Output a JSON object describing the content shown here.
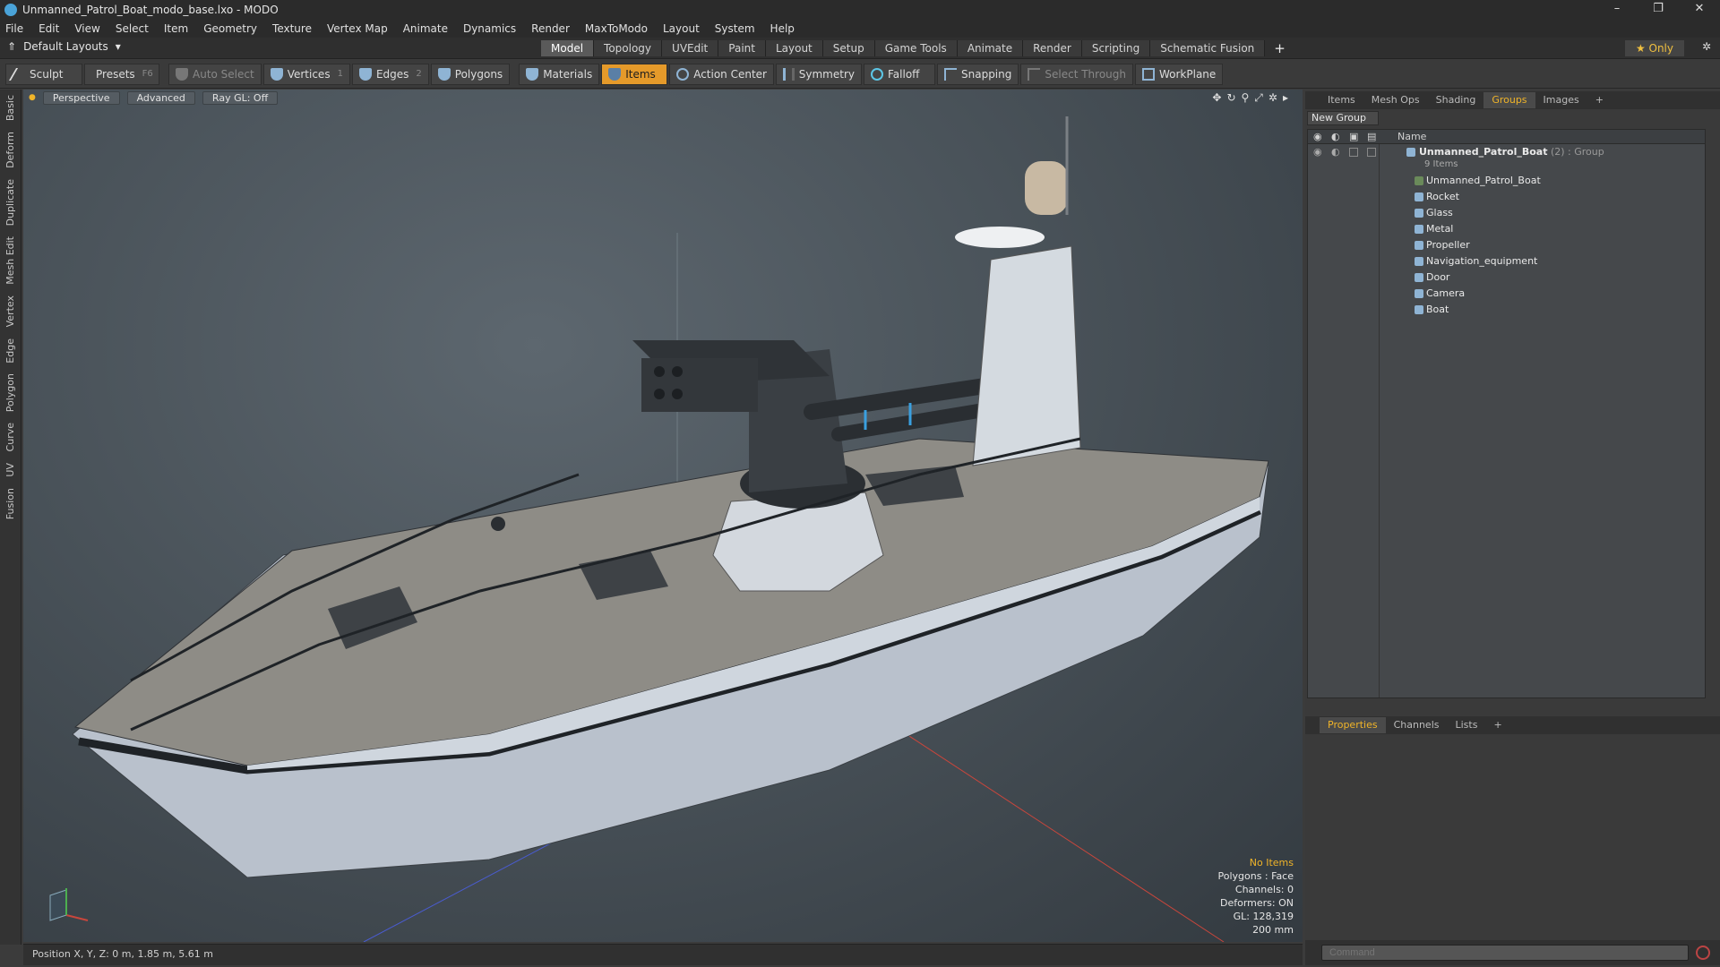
{
  "window": {
    "title": "Unmanned_Patrol_Boat_modo_base.lxo - MODO",
    "minimize": "–",
    "maximize": "❐",
    "close": "✕"
  },
  "menu": [
    "File",
    "Edit",
    "View",
    "Select",
    "Item",
    "Geometry",
    "Texture",
    "Vertex Map",
    "Animate",
    "Dynamics",
    "Render",
    "MaxToModo",
    "Layout",
    "System",
    "Help"
  ],
  "layouts": {
    "label": "Default Layouts"
  },
  "layout_tabs": {
    "items": [
      "Model",
      "Topology",
      "UVEdit",
      "Paint",
      "Layout",
      "Setup",
      "Game Tools",
      "Animate",
      "Render",
      "Scripting",
      "Schematic Fusion"
    ],
    "active": "Model",
    "add": "+",
    "only": "★ Only"
  },
  "toolbar": {
    "sculpt": "Sculpt",
    "presets": "Presets",
    "presets_key": "F6",
    "auto_select": "Auto Select",
    "vertices": "Vertices",
    "vertices_key": "1",
    "edges": "Edges",
    "edges_key": "2",
    "polygons": "Polygons",
    "materials": "Materials",
    "items": "Items",
    "action_center": "Action Center",
    "symmetry": "Symmetry",
    "falloff": "Falloff",
    "snapping": "Snapping",
    "select_through": "Select Through",
    "workplane": "WorkPlane"
  },
  "left_strip": [
    "Basic",
    "Deform",
    "Duplicate",
    "Mesh Edit",
    "Vertex",
    "Edge",
    "Polygon",
    "Curve",
    "UV",
    "Fusion"
  ],
  "viewport": {
    "view": "Perspective",
    "shading": "Advanced",
    "raygl": "Ray GL: Off",
    "info": {
      "selection": "No Items",
      "polygons": "Polygons : Face",
      "channels": "Channels: 0",
      "deformers": "Deformers: ON",
      "gl": "GL: 128,319",
      "scale": "200 mm"
    }
  },
  "status": {
    "position": "Position X, Y, Z:  0 m, 1.85 m, 5.61 m"
  },
  "right_tabs": {
    "items": [
      "Items",
      "Mesh Ops",
      "Shading",
      "Groups",
      "Images"
    ],
    "active": "Groups",
    "add": "+"
  },
  "groups": {
    "new_group": "New Group",
    "col_name": "Name",
    "group": {
      "name": "Unmanned_Patrol_Boat",
      "suffix": " (2) : Group",
      "count": "9 Items"
    },
    "items": [
      "Unmanned_Patrol_Boat",
      "Rocket",
      "Glass",
      "Metal",
      "Propeller",
      "Navigation_equipment",
      "Door",
      "Camera",
      "Boat"
    ]
  },
  "bottom_tabs": {
    "items": [
      "Properties",
      "Channels",
      "Lists"
    ],
    "active": "Properties",
    "add": "+"
  },
  "command": {
    "placeholder": "Command"
  }
}
